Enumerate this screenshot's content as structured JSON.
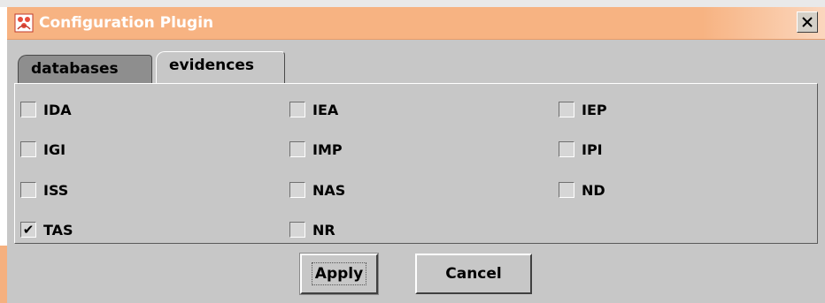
{
  "window": {
    "title": "Configuration Plugin",
    "close_glyph": "×",
    "icon": "plugin-app-icon",
    "accent": "#f7b382"
  },
  "tabs": [
    {
      "label": "databases",
      "selected": false
    },
    {
      "label": "evidences",
      "selected": true
    }
  ],
  "checkboxes": [
    {
      "label": "IDA",
      "checked": false
    },
    {
      "label": "IEA",
      "checked": false
    },
    {
      "label": "IEP",
      "checked": false
    },
    {
      "label": "IGI",
      "checked": false
    },
    {
      "label": "IMP",
      "checked": false
    },
    {
      "label": "IPI",
      "checked": false
    },
    {
      "label": "ISS",
      "checked": false
    },
    {
      "label": "NAS",
      "checked": false
    },
    {
      "label": "ND",
      "checked": false
    },
    {
      "label": "TAS",
      "checked": true
    },
    {
      "label": "NR",
      "checked": false
    }
  ],
  "check_glyph": "✔",
  "buttons": {
    "apply": "Apply",
    "cancel": "Cancel"
  }
}
